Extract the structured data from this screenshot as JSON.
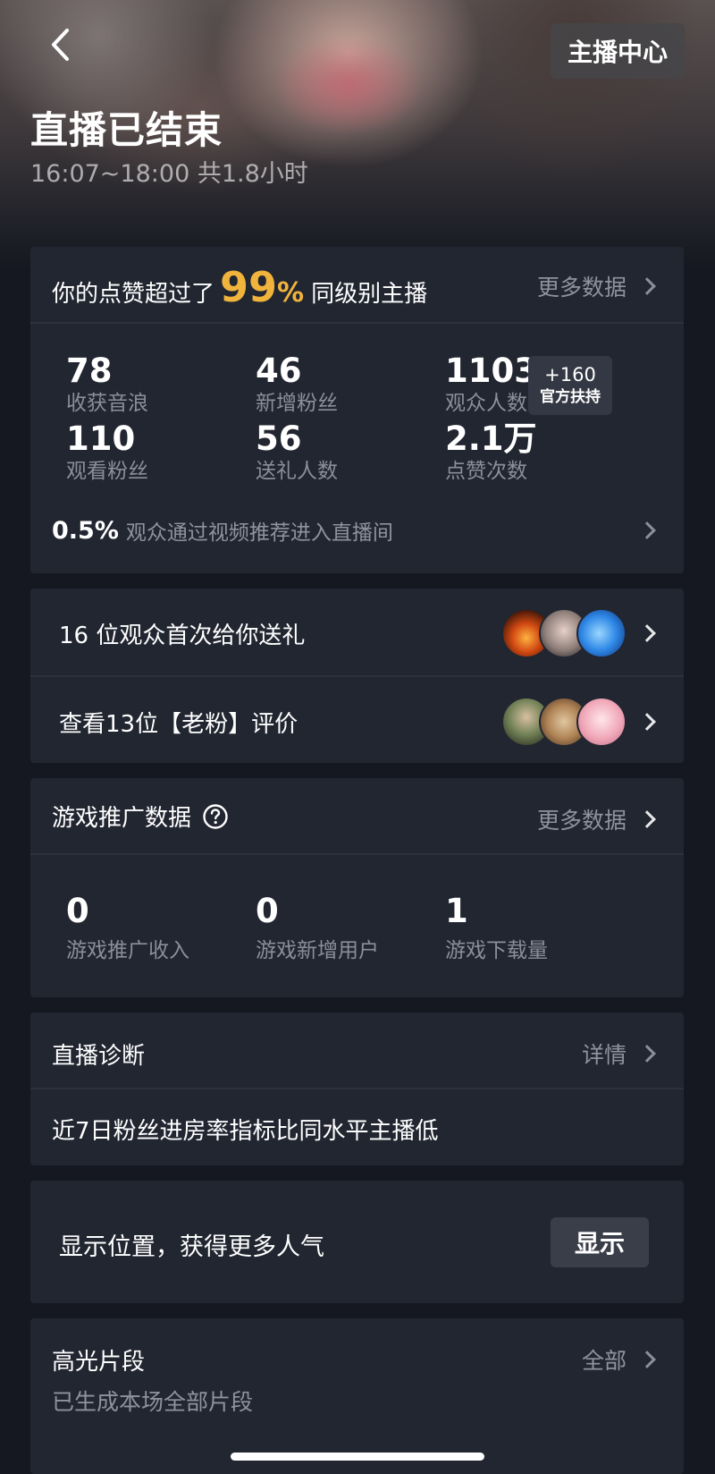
{
  "header": {
    "back_icon": "chevron-left-icon",
    "center_button": "主播中心",
    "title": "直播已结束",
    "subtitle": "16:07~18:00 共1.8小时"
  },
  "summary": {
    "likes_prefix": "你的点赞超过了",
    "likes_percent": "99",
    "percent_sign": "%",
    "likes_suffix": "同级别主播",
    "more_label": "更多数据",
    "stats": [
      {
        "value": "78",
        "label": "收获音浪"
      },
      {
        "value": "46",
        "label": "新增粉丝"
      },
      {
        "value": "1103",
        "label": "观众人数"
      },
      {
        "value": "110",
        "label": "观看粉丝"
      },
      {
        "value": "56",
        "label": "送礼人数"
      },
      {
        "value": "2.1万",
        "label": "点赞次数"
      }
    ],
    "badge_top": "+160",
    "badge_bottom": "官方扶持",
    "recommend_value": "0.5%",
    "recommend_text": "观众通过视频推荐进入直播间"
  },
  "gifts": {
    "first_gift_text": "16 位观众首次给你送礼",
    "fans_review_text": "查看13位【老粉】评价"
  },
  "game": {
    "title": "游戏推广数据",
    "more_label": "更多数据",
    "stats": [
      {
        "value": "0",
        "label": "游戏推广收入"
      },
      {
        "value": "0",
        "label": "游戏新增用户"
      },
      {
        "value": "1",
        "label": "游戏下载量"
      }
    ]
  },
  "diagnosis": {
    "title": "直播诊断",
    "detail_label": "详情",
    "text": "近7日粉丝进房率指标比同水平主播低"
  },
  "location": {
    "text": "显示位置，获得更多人气",
    "button": "显示"
  },
  "highlights": {
    "title": "高光片段",
    "all_label": "全部",
    "subtitle": "已生成本场全部片段"
  },
  "colors": {
    "accent": "#f0b43c",
    "card_bg": "#222631",
    "page_bg": "#161821"
  }
}
